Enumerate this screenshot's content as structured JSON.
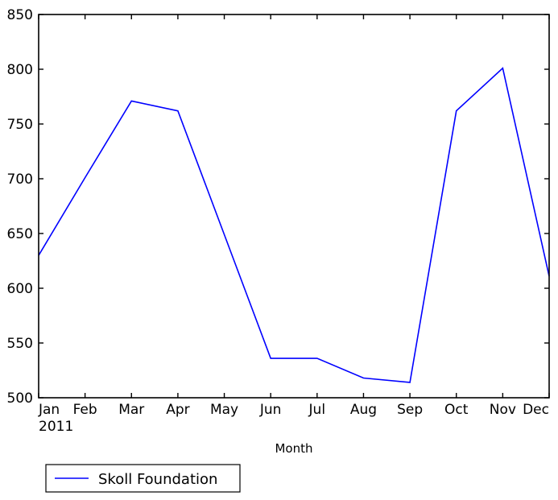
{
  "chart_data": {
    "type": "line",
    "title": "",
    "subtitle": "",
    "xlabel": "Month",
    "ylabel": "",
    "categories": [
      "Jan",
      "Feb",
      "Mar",
      "Apr",
      "May",
      "Jun",
      "Jul",
      "Aug",
      "Sep",
      "Oct",
      "Nov",
      "Dec"
    ],
    "x_period_label": "2011",
    "xtick_labels": [
      "Jan",
      "Feb",
      "Mar",
      "Apr",
      "May",
      "Jun",
      "Jul",
      "Aug",
      "Sep",
      "Oct",
      "Nov",
      "Dec"
    ],
    "ytick_labels": [
      "500",
      "550",
      "600",
      "650",
      "700",
      "750",
      "800",
      "850"
    ],
    "yticks": [
      500,
      550,
      600,
      650,
      700,
      750,
      800,
      850
    ],
    "ylim": [
      500,
      850
    ],
    "xlim": [
      0,
      11
    ],
    "grid": false,
    "legend_position": "below-axes-left",
    "series": [
      {
        "name": "Skoll Foundation",
        "color": "#0000ff",
        "values": [
          630,
          701,
          771,
          762,
          649,
          536,
          536,
          518,
          514,
          762,
          801,
          611
        ]
      }
    ],
    "legend": [
      {
        "label": "Skoll Foundation",
        "color": "#0000ff",
        "marker": "line"
      }
    ],
    "annotations": []
  },
  "figure": {
    "background": "#ffffff",
    "axes_edge_color": "#000000",
    "tick_color": "#000000"
  }
}
